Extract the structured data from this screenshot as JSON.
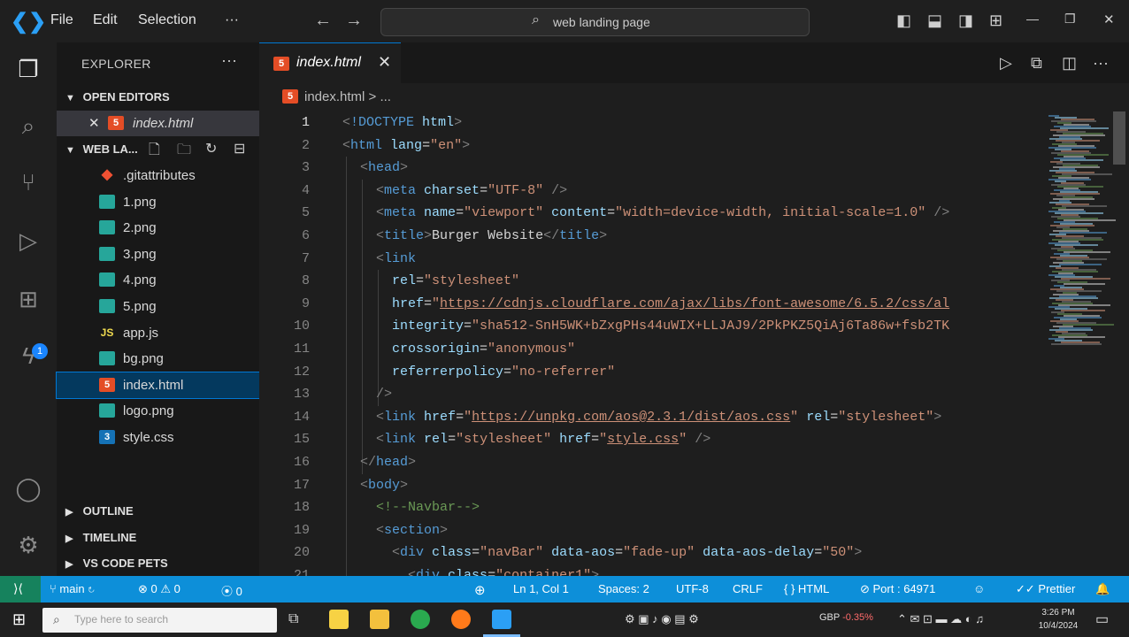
{
  "titlebar": {
    "menus": [
      "File",
      "Edit",
      "Selection",
      "···"
    ],
    "search_text": "web landing page"
  },
  "sidebar": {
    "title": "EXPLORER",
    "open_editors_label": "OPEN EDITORS",
    "open_editor_file": "index.html",
    "workspace_label": "WEB LA...",
    "files": [
      {
        "name": ".gitattributes",
        "type": "git"
      },
      {
        "name": "1.png",
        "type": "png"
      },
      {
        "name": "2.png",
        "type": "png"
      },
      {
        "name": "3.png",
        "type": "png"
      },
      {
        "name": "4.png",
        "type": "png"
      },
      {
        "name": "5.png",
        "type": "png"
      },
      {
        "name": "app.js",
        "type": "js"
      },
      {
        "name": "bg.png",
        "type": "png"
      },
      {
        "name": "index.html",
        "type": "html",
        "selected": true
      },
      {
        "name": "logo.png",
        "type": "png"
      },
      {
        "name": "style.css",
        "type": "css"
      }
    ],
    "outline_label": "OUTLINE",
    "timeline_label": "TIMELINE",
    "pets_label": "VS CODE PETS"
  },
  "tab": {
    "name": "index.html"
  },
  "breadcrumb": {
    "file": "index.html",
    "rest": "> ..."
  },
  "editor": {
    "lines": [
      {
        "n": "1",
        "indent": 0,
        "tokens": [
          [
            "punc",
            "<"
          ],
          [
            "tag",
            "!DOCTYPE"
          ],
          [
            "txt",
            " "
          ],
          [
            "attr",
            "html"
          ],
          [
            "punc",
            ">"
          ]
        ]
      },
      {
        "n": "2",
        "indent": 0,
        "tokens": [
          [
            "punc",
            "<"
          ],
          [
            "tag",
            "html"
          ],
          [
            "txt",
            " "
          ],
          [
            "attr",
            "lang"
          ],
          [
            "txt",
            "="
          ],
          [
            "str",
            "\"en\""
          ],
          [
            "punc",
            ">"
          ]
        ]
      },
      {
        "n": "3",
        "indent": 1,
        "tokens": [
          [
            "punc",
            "<"
          ],
          [
            "tag",
            "head"
          ],
          [
            "punc",
            ">"
          ]
        ]
      },
      {
        "n": "4",
        "indent": 2,
        "tokens": [
          [
            "punc",
            "<"
          ],
          [
            "tag",
            "meta"
          ],
          [
            "txt",
            " "
          ],
          [
            "attr",
            "charset"
          ],
          [
            "txt",
            "="
          ],
          [
            "str",
            "\"UTF-8\""
          ],
          [
            "txt",
            " "
          ],
          [
            "punc",
            "/>"
          ]
        ]
      },
      {
        "n": "5",
        "indent": 2,
        "tokens": [
          [
            "punc",
            "<"
          ],
          [
            "tag",
            "meta"
          ],
          [
            "txt",
            " "
          ],
          [
            "attr",
            "name"
          ],
          [
            "txt",
            "="
          ],
          [
            "str",
            "\"viewport\""
          ],
          [
            "txt",
            " "
          ],
          [
            "attr",
            "content"
          ],
          [
            "txt",
            "="
          ],
          [
            "str",
            "\"width=device-width, initial-scale=1.0\""
          ],
          [
            "txt",
            " "
          ],
          [
            "punc",
            "/>"
          ]
        ]
      },
      {
        "n": "6",
        "indent": 2,
        "tokens": [
          [
            "punc",
            "<"
          ],
          [
            "tag",
            "title"
          ],
          [
            "punc",
            ">"
          ],
          [
            "txt",
            "Burger Website"
          ],
          [
            "punc",
            "</"
          ],
          [
            "tag",
            "title"
          ],
          [
            "punc",
            ">"
          ]
        ]
      },
      {
        "n": "7",
        "indent": 2,
        "tokens": [
          [
            "punc",
            "<"
          ],
          [
            "tag",
            "link"
          ]
        ]
      },
      {
        "n": "8",
        "indent": 3,
        "tokens": [
          [
            "attr",
            "rel"
          ],
          [
            "txt",
            "="
          ],
          [
            "str",
            "\"stylesheet\""
          ]
        ]
      },
      {
        "n": "9",
        "indent": 3,
        "tokens": [
          [
            "attr",
            "href"
          ],
          [
            "txt",
            "="
          ],
          [
            "str",
            "\""
          ],
          [
            "url",
            "https://cdnjs.cloudflare.com/ajax/libs/font-awesome/6.5.2/css/al"
          ]
        ]
      },
      {
        "n": "10",
        "indent": 3,
        "tokens": [
          [
            "attr",
            "integrity"
          ],
          [
            "txt",
            "="
          ],
          [
            "str",
            "\"sha512-SnH5WK+bZxgPHs44uWIX+LLJAJ9/2PkPKZ5QiAj6Ta86w+fsb2TK"
          ]
        ]
      },
      {
        "n": "11",
        "indent": 3,
        "tokens": [
          [
            "attr",
            "crossorigin"
          ],
          [
            "txt",
            "="
          ],
          [
            "str",
            "\"anonymous\""
          ]
        ]
      },
      {
        "n": "12",
        "indent": 3,
        "tokens": [
          [
            "attr",
            "referrerpolicy"
          ],
          [
            "txt",
            "="
          ],
          [
            "str",
            "\"no-referrer\""
          ]
        ]
      },
      {
        "n": "13",
        "indent": 2,
        "tokens": [
          [
            "punc",
            "/>"
          ]
        ]
      },
      {
        "n": "14",
        "indent": 2,
        "tokens": [
          [
            "punc",
            "<"
          ],
          [
            "tag",
            "link"
          ],
          [
            "txt",
            " "
          ],
          [
            "attr",
            "href"
          ],
          [
            "txt",
            "="
          ],
          [
            "str",
            "\""
          ],
          [
            "url",
            "https://unpkg.com/aos@2.3.1/dist/aos.css"
          ],
          [
            "str",
            "\""
          ],
          [
            "txt",
            " "
          ],
          [
            "attr",
            "rel"
          ],
          [
            "txt",
            "="
          ],
          [
            "str",
            "\"stylesheet\""
          ],
          [
            "punc",
            ">"
          ]
        ]
      },
      {
        "n": "15",
        "indent": 2,
        "tokens": [
          [
            "punc",
            "<"
          ],
          [
            "tag",
            "link"
          ],
          [
            "txt",
            " "
          ],
          [
            "attr",
            "rel"
          ],
          [
            "txt",
            "="
          ],
          [
            "str",
            "\"stylesheet\""
          ],
          [
            "txt",
            " "
          ],
          [
            "attr",
            "href"
          ],
          [
            "txt",
            "="
          ],
          [
            "str",
            "\""
          ],
          [
            "url",
            "style.css"
          ],
          [
            "str",
            "\""
          ],
          [
            "txt",
            " "
          ],
          [
            "punc",
            "/>"
          ]
        ]
      },
      {
        "n": "16",
        "indent": 1,
        "tokens": [
          [
            "punc",
            "</"
          ],
          [
            "tag",
            "head"
          ],
          [
            "punc",
            ">"
          ]
        ]
      },
      {
        "n": "17",
        "indent": 1,
        "tokens": [
          [
            "punc",
            "<"
          ],
          [
            "tag",
            "body"
          ],
          [
            "punc",
            ">"
          ]
        ]
      },
      {
        "n": "18",
        "indent": 2,
        "tokens": [
          [
            "cm",
            "<!--Navbar-->"
          ]
        ]
      },
      {
        "n": "19",
        "indent": 2,
        "tokens": [
          [
            "punc",
            "<"
          ],
          [
            "tag",
            "section"
          ],
          [
            "punc",
            ">"
          ]
        ]
      },
      {
        "n": "20",
        "indent": 3,
        "tokens": [
          [
            "punc",
            "<"
          ],
          [
            "tag",
            "div"
          ],
          [
            "txt",
            " "
          ],
          [
            "attr",
            "class"
          ],
          [
            "txt",
            "="
          ],
          [
            "str",
            "\"navBar\""
          ],
          [
            "txt",
            " "
          ],
          [
            "attr",
            "data-aos"
          ],
          [
            "txt",
            "="
          ],
          [
            "str",
            "\"fade-up\""
          ],
          [
            "txt",
            " "
          ],
          [
            "attr",
            "data-aos-delay"
          ],
          [
            "txt",
            "="
          ],
          [
            "str",
            "\"50\""
          ],
          [
            "punc",
            ">"
          ]
        ]
      },
      {
        "n": "21",
        "indent": 4,
        "tokens": [
          [
            "punc",
            "<"
          ],
          [
            "tag",
            "div"
          ],
          [
            "txt",
            " "
          ],
          [
            "attr",
            "class"
          ],
          [
            "txt",
            "="
          ],
          [
            "str",
            "\"container1\""
          ],
          [
            "punc",
            ">"
          ]
        ]
      }
    ]
  },
  "statusbar": {
    "branch": "main",
    "problems": "⊗ 0 ⚠ 0",
    "ports_count": "0",
    "position": "Ln 1, Col 1",
    "spaces": "Spaces: 2",
    "encoding": "UTF-8",
    "eol": "CRLF",
    "language": "HTML",
    "port": "Port : 64971",
    "prettier": "Prettier"
  },
  "taskbar": {
    "search_placeholder": "Type here to search",
    "stock": "GBP",
    "stock_change": "-0.35%",
    "time": "3:26 PM",
    "date": "10/4/2024"
  }
}
